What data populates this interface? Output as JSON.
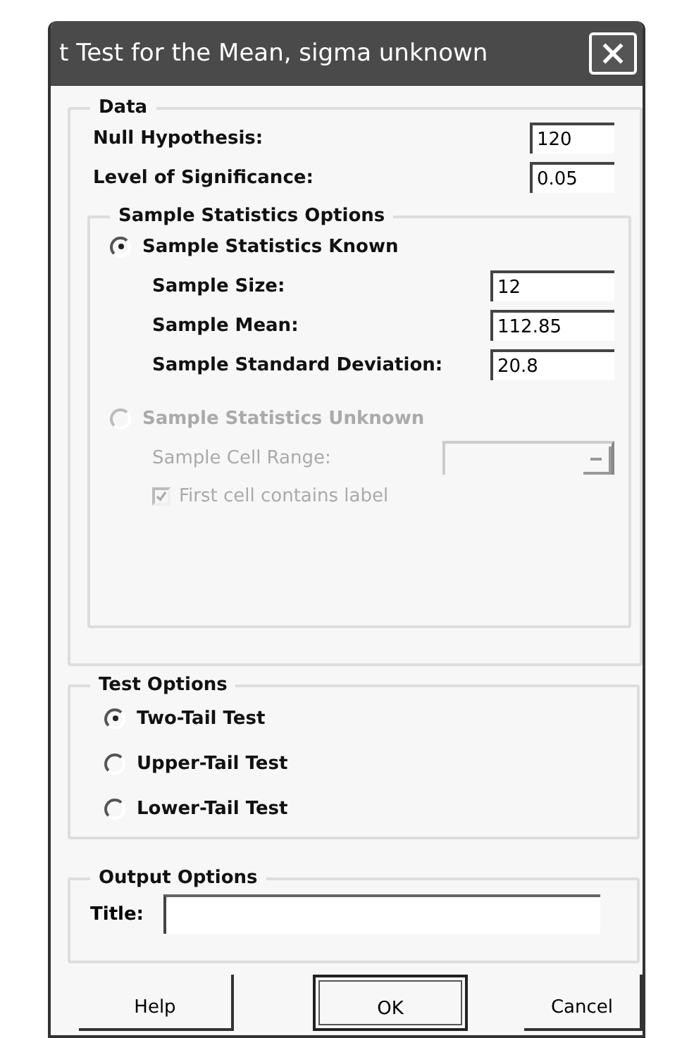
{
  "window": {
    "title": "t Test for the Mean, sigma unknown"
  },
  "data_group": {
    "legend": "Data",
    "fields": [
      {
        "label": "Null Hypothesis:",
        "value": "120"
      },
      {
        "label": "Level of Significance:",
        "value": "0.05"
      }
    ],
    "sample_statistics": {
      "legend": "Sample Statistics Options",
      "options": [
        {
          "kind": "known",
          "label": "Sample Statistics Known",
          "selected": true,
          "disabled": false,
          "fields": [
            {
              "label": "Sample Size:",
              "value": "12"
            },
            {
              "label": "Sample Mean:",
              "value": "112.85"
            },
            {
              "label": "Sample Standard Deviation:",
              "value": "20.8"
            }
          ]
        },
        {
          "kind": "unknown",
          "label": "Sample Statistics Unknown",
          "selected": false,
          "disabled": true,
          "range_label": "Sample Cell Range:",
          "checkbox": {
            "label": "First cell contains label",
            "checked": true
          }
        }
      ]
    }
  },
  "test_options": {
    "legend": "Test Options",
    "options": [
      {
        "label": "Two-Tail Test",
        "selected": true
      },
      {
        "label": "Upper-Tail Test",
        "selected": false
      },
      {
        "label": "Lower-Tail Test",
        "selected": false
      }
    ]
  },
  "output_options": {
    "legend": "Output Options",
    "title_label": "Title:"
  },
  "buttons": [
    {
      "label": "Help",
      "focused": false
    },
    {
      "label": "OK",
      "focused": true
    },
    {
      "label": "Cancel",
      "focused": false
    }
  ]
}
